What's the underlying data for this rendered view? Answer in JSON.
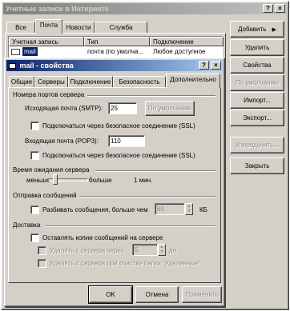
{
  "main_window": {
    "title": "Учетные записи в Интернете",
    "help_btn": "?",
    "close_btn": "×",
    "tabs": [
      "Все",
      "Почта",
      "Новости",
      "Служба каталогов"
    ],
    "columns": [
      "Учетная запись",
      "Тип",
      "Подключение"
    ],
    "row": {
      "account": "mail",
      "type": "почта (по умолча...",
      "connection": "Любое доступное"
    },
    "buttons": {
      "add": "Добавить",
      "delete": "Удалить",
      "properties": "Свойства",
      "default": "По умолчанию",
      "import": "Импорт...",
      "export": "Экспорт...",
      "order": "Упорядочить...",
      "close": "Закрыть"
    },
    "add_arrow": "▶"
  },
  "dialog": {
    "title": "mail - свойства",
    "help_btn": "?",
    "close_btn": "×",
    "tabs": [
      "Общие",
      "Серверы",
      "Подключение",
      "Безопасность",
      "Дополнительно"
    ],
    "ports_group": "Номера портов сервера",
    "smtp_label": "Исходящая почта (SMTP):",
    "smtp_value": "25",
    "default_button": "По умолчанию",
    "ssl1_label": "Подключаться через безопасное соединение (SSL)",
    "pop3_label": "Входящая почта (POP3):",
    "pop3_value": "110",
    "ssl2_label": "Подключаться через безопасное соединение (SSL)",
    "timeout_group": "Время ожидания сервера",
    "less": "меньше",
    "more": "больше",
    "timeout_value": "1 мин.",
    "send_group": "Отправка сообщений",
    "split_label": "Разбивать сообщения, больше чем",
    "split_value": "60",
    "split_unit": "КБ",
    "delivery_group": "Доставка",
    "keep_label": "Оставлять копии сообщений на сервере",
    "remove_label": "Удалять с сервера через",
    "remove_value": "5",
    "remove_unit": "дн.",
    "remove_trash_label": "Удалять с сервера при очистке папки \"Удаленные\"",
    "ok": "OK",
    "cancel": "Отмена",
    "apply": "Применить"
  }
}
